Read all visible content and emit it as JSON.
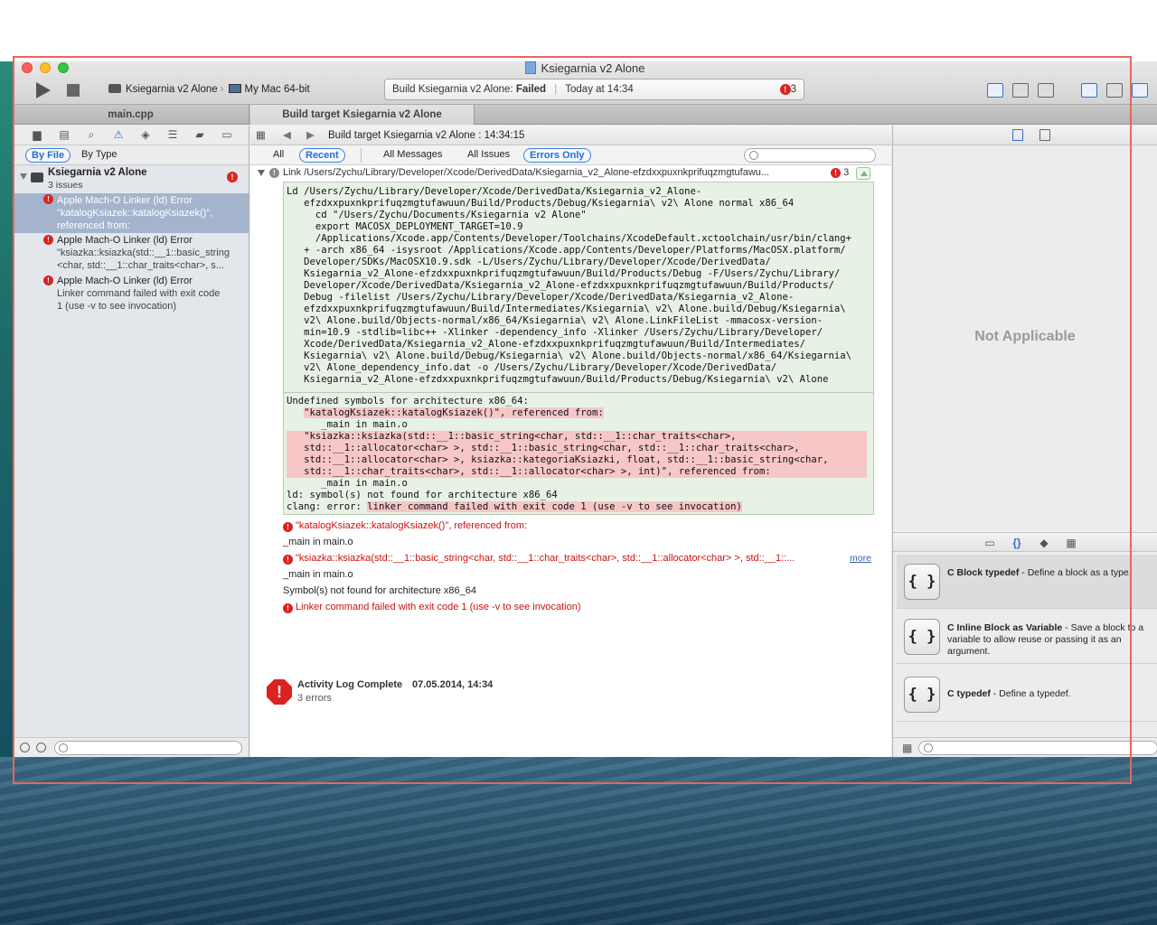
{
  "window": {
    "title": "Ksiegarnia v2 Alone"
  },
  "toolbar": {
    "scheme": "Ksiegarnia v2 Alone",
    "destination": "My Mac 64-bit",
    "activity_prefix": "Build Ksiegarnia v2 Alone:",
    "activity_status": "Failed",
    "activity_time": "Today at 14:34",
    "activity_error_count": "3"
  },
  "tabs": [
    {
      "label": "main.cpp"
    },
    {
      "label": "Build target Ksiegarnia v2 Alone"
    }
  ],
  "navigator": {
    "filter_by_file": "By File",
    "filter_by_type": "By Type",
    "project_name": "Ksiegarnia v2 Alone",
    "project_issues": "3 issues",
    "issues": [
      {
        "title": "Apple Mach-O Linker (ld) Error",
        "line1": "\"katalogKsiazek::katalogKsiazek()\",",
        "line2": "referenced from:"
      },
      {
        "title": "Apple Mach-O Linker (ld) Error",
        "line1": "\"ksiazka::ksiazka(std::__1::basic_string",
        "line2": "<char, std::__1::char_traits<char>, s..."
      },
      {
        "title": "Apple Mach-O Linker (ld) Error",
        "line1": "Linker command failed with exit code",
        "line2": "1 (use -v to see invocation)"
      }
    ]
  },
  "editor": {
    "jump_path": "Build target Ksiegarnia v2 Alone : 14:34:15",
    "scope": {
      "all": "All",
      "recent": "Recent",
      "all_messages": "All Messages",
      "all_issues": "All Issues",
      "errors_only": "Errors Only"
    },
    "link_row": "Link /Users/Zychu/Library/Developer/Xcode/DerivedData/Ksiegarnia_v2_Alone-efzdxxpuxnkprifuqzmgtufawu...",
    "link_error_count": "3",
    "command_lines": [
      "Ld /Users/Zychu/Library/Developer/Xcode/DerivedData/Ksiegarnia_v2_Alone-",
      "   efzdxxpuxnkprifuqzmgtufawuun/Build/Products/Debug/Ksiegarnia\\ v2\\ Alone normal x86_64",
      "     cd \"/Users/Zychu/Documents/Ksiegarnia v2 Alone\"",
      "     export MACOSX_DEPLOYMENT_TARGET=10.9",
      "     /Applications/Xcode.app/Contents/Developer/Toolchains/XcodeDefault.xctoolchain/usr/bin/clang+",
      "   + -arch x86_64 -isysroot /Applications/Xcode.app/Contents/Developer/Platforms/MacOSX.platform/",
      "   Developer/SDKs/MacOSX10.9.sdk -L/Users/Zychu/Library/Developer/Xcode/DerivedData/",
      "   Ksiegarnia_v2_Alone-efzdxxpuxnkprifuqzmgtufawuun/Build/Products/Debug -F/Users/Zychu/Library/",
      "   Developer/Xcode/DerivedData/Ksiegarnia_v2_Alone-efzdxxpuxnkprifuqzmgtufawuun/Build/Products/",
      "   Debug -filelist /Users/Zychu/Library/Developer/Xcode/DerivedData/Ksiegarnia_v2_Alone-",
      "   efzdxxpuxnkprifuqzmgtufawuun/Build/Intermediates/Ksiegarnia\\ v2\\ Alone.build/Debug/Ksiegarnia\\",
      "   v2\\ Alone.build/Objects-normal/x86_64/Ksiegarnia\\ v2\\ Alone.LinkFileList -mmacosx-version-",
      "   min=10.9 -stdlib=libc++ -Xlinker -dependency_info -Xlinker /Users/Zychu/Library/Developer/",
      "   Xcode/DerivedData/Ksiegarnia_v2_Alone-efzdxxpuxnkprifuqzmgtufawuun/Build/Intermediates/",
      "   Ksiegarnia\\ v2\\ Alone.build/Debug/Ksiegarnia\\ v2\\ Alone.build/Objects-normal/x86_64/Ksiegarnia\\",
      "   v2\\ Alone_dependency_info.dat -o /Users/Zychu/Library/Developer/Xcode/DerivedData/",
      "   Ksiegarnia_v2_Alone-efzdxxpuxnkprifuqzmgtufawuun/Build/Products/Debug/Ksiegarnia\\ v2\\ Alone"
    ],
    "out_undefined": "Undefined symbols for architecture x86_64:",
    "out_sym1": "\"katalogKsiazek::katalogKsiazek()\", referenced from:",
    "out_main1": "      _main in main.o",
    "out_sym2_lines": [
      "   \"ksiazka::ksiazka(std::__1::basic_string<char, std::__1::char_traits<char>,",
      "   std::__1::allocator<char> >, std::__1::basic_string<char, std::__1::char_traits<char>,",
      "   std::__1::allocator<char> >, ksiazka::kategoriaKsiazki, float, std::__1::basic_string<char,",
      "   std::__1::char_traits<char>, std::__1::allocator<char> >, int)\", referenced from:"
    ],
    "out_main2": "      _main in main.o",
    "out_ld": "ld: symbol(s) not found for architecture x86_64",
    "out_clang_prefix": "clang: error: ",
    "out_clang_msg": "linker command failed with exit code 1 (use -v to see invocation)",
    "msg1": "\"katalogKsiazek::katalogKsiazek()\", referenced from:",
    "msg1_sub": "_main in main.o",
    "msg2": "\"ksiazka::ksiazka(std::__1::basic_string<char, std::__1::char_traits<char>, std::__1::allocator<char> >, std::__1::...",
    "msg2_more": "more",
    "msg2_sub": "_main in main.o",
    "msg3": "Symbol(s) not found for architecture x86_64",
    "msg4": "Linker command failed with exit code 1 (use -v to see invocation)",
    "complete_title": "Activity Log Complete",
    "complete_date": "07.05.2014, 14:34",
    "complete_errors": "3 errors"
  },
  "utilities": {
    "not_applicable": "Not Applicable",
    "library": [
      {
        "symbol": "{ }",
        "name": "C Block typedef",
        "desc": " - Define a block as a type."
      },
      {
        "symbol": "{ }",
        "name": "C Inline Block as Variable",
        "desc": " - Save a block to a variable to allow reuse or passing it as an argument."
      },
      {
        "symbol": "{ }",
        "name": "C typedef",
        "desc": " - Define a typedef."
      }
    ]
  },
  "colors": {
    "error": "#dd2222",
    "accent": "#2e6fd6",
    "highlight": "#f6c7c6",
    "console_bg": "#e8f1e6"
  }
}
